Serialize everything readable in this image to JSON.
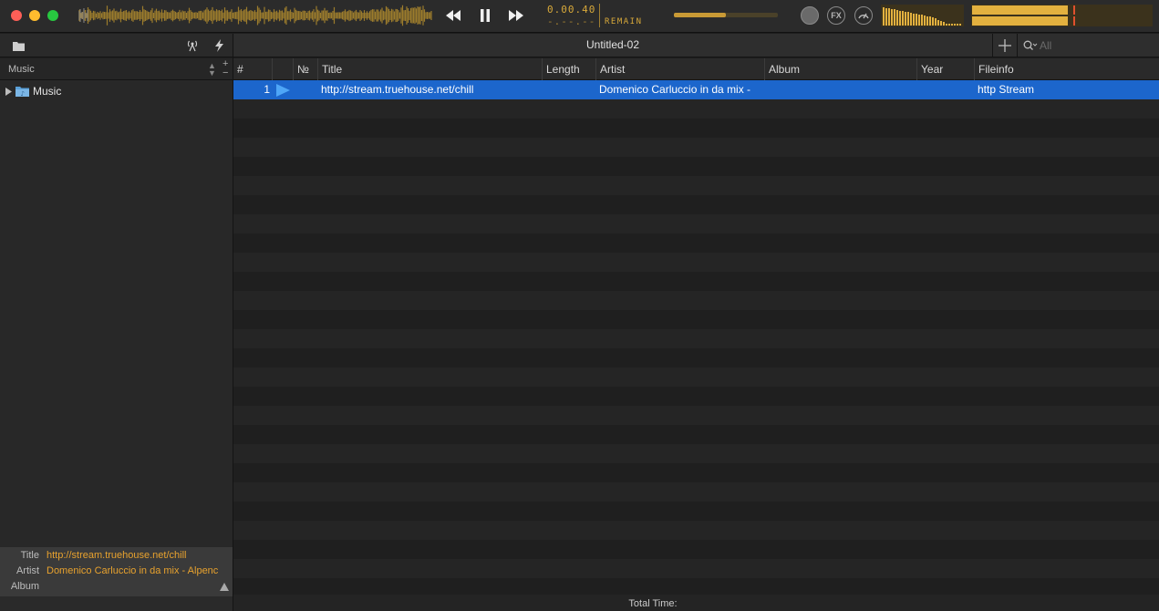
{
  "player": {
    "time_elapsed": "0.00.40",
    "time_remaining": "-.--.--",
    "time_mode": "REMAIN",
    "volume_level": 0.5,
    "fx_label": "FX"
  },
  "sidebar": {
    "source_selector": "Music",
    "tree": [
      {
        "label": "Music",
        "expanded": false
      }
    ]
  },
  "now_playing": {
    "title_key": "Title",
    "title_value": "http://stream.truehouse.net/chill",
    "artist_key": "Artist",
    "artist_value": "Domenico Carluccio in da mix - Alpenc",
    "album_key": "Album",
    "album_value": ""
  },
  "playlist": {
    "tab_title": "Untitled-02",
    "search_placeholder": "All",
    "columns": {
      "index": "#",
      "number": "№",
      "title": "Title",
      "length": "Length",
      "artist": "Artist",
      "album": "Album",
      "year": "Year",
      "fileinfo": "Fileinfo"
    },
    "rows": [
      {
        "index": "1",
        "number": "",
        "title": "http://stream.truehouse.net/chill",
        "length": "",
        "artist": "Domenico Carluccio in da mix -",
        "album": "",
        "year": "",
        "fileinfo": "http Stream",
        "playing": true
      }
    ],
    "total_time_label": "Total Time:"
  },
  "colors": {
    "accent_lcd": "#d8a93a",
    "selection": "#1c66cc",
    "now_playing_text": "#e8a22e"
  }
}
